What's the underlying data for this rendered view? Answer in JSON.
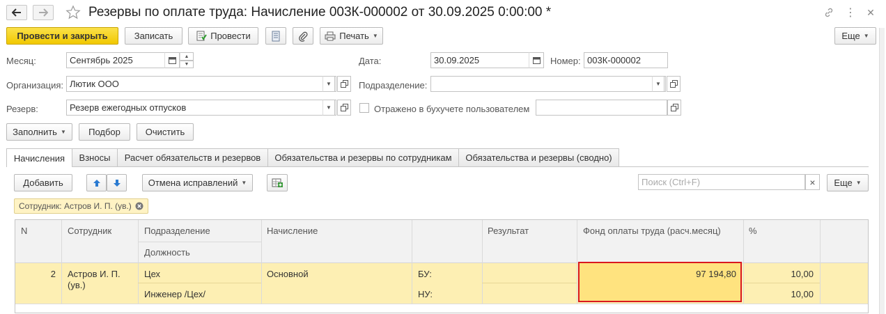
{
  "window": {
    "title": "Резервы по оплате труда: Начисление 003К-000002 от 30.09.2025 0:00:00 *"
  },
  "toolbar": {
    "post_close": "Провести и закрыть",
    "save": "Записать",
    "post": "Провести",
    "print": "Печать",
    "more": "Еще"
  },
  "form": {
    "month_label": "Месяц:",
    "month_value": "Сентябрь 2025",
    "date_label": "Дата:",
    "date_value": "30.09.2025",
    "number_label": "Номер:",
    "number_value": "003К-000002",
    "org_label": "Организация:",
    "org_value": "Лютик ООО",
    "dept_label": "Подразделение:",
    "dept_value": "",
    "reserve_label": "Резерв:",
    "reserve_value": "Резерв ежегодных отпусков",
    "reflected_label": "Отражено в бухучете пользователем",
    "reflected_value": ""
  },
  "actions": {
    "fill": "Заполнить",
    "select": "Подбор",
    "clear": "Очистить"
  },
  "tabs": [
    {
      "label": "Начисления",
      "active": true
    },
    {
      "label": "Взносы",
      "active": false
    },
    {
      "label": "Расчет обязательств и резервов",
      "active": false
    },
    {
      "label": "Обязательства и резервы по сотрудникам",
      "active": false
    },
    {
      "label": "Обязательства и резервы (сводно)",
      "active": false
    }
  ],
  "table_toolbar": {
    "add": "Добавить",
    "cancel_corrections": "Отмена исправлений",
    "search_placeholder": "Поиск (Ctrl+F)",
    "clear_search": "×",
    "more": "Еще"
  },
  "filter_chip": "Сотрудник: Астров И. П. (ув.)",
  "table": {
    "columns": {
      "n": "N",
      "employee": "Сотрудник",
      "department": "Подразделение",
      "position": "Должность",
      "accrual": "Начисление",
      "result": "Результат",
      "fund": "Фонд оплаты труда (расч.месяц)",
      "percent": "%"
    },
    "rows": [
      {
        "n": "2",
        "employee": "Астров И. П. (ув.)",
        "department": "Цех",
        "position": "Инженер /Цех/",
        "accrual": "Основной",
        "bu_label": "БУ:",
        "nu_label": "НУ:",
        "fund": "97 194,80",
        "percent_bu": "10,00",
        "percent_nu": "10,00"
      }
    ]
  },
  "colors": {
    "primary_button": "#f1c800",
    "row_highlight": "#fdefb3",
    "selected_cell": "#ffe37f",
    "selection_border": "#d9181f"
  }
}
